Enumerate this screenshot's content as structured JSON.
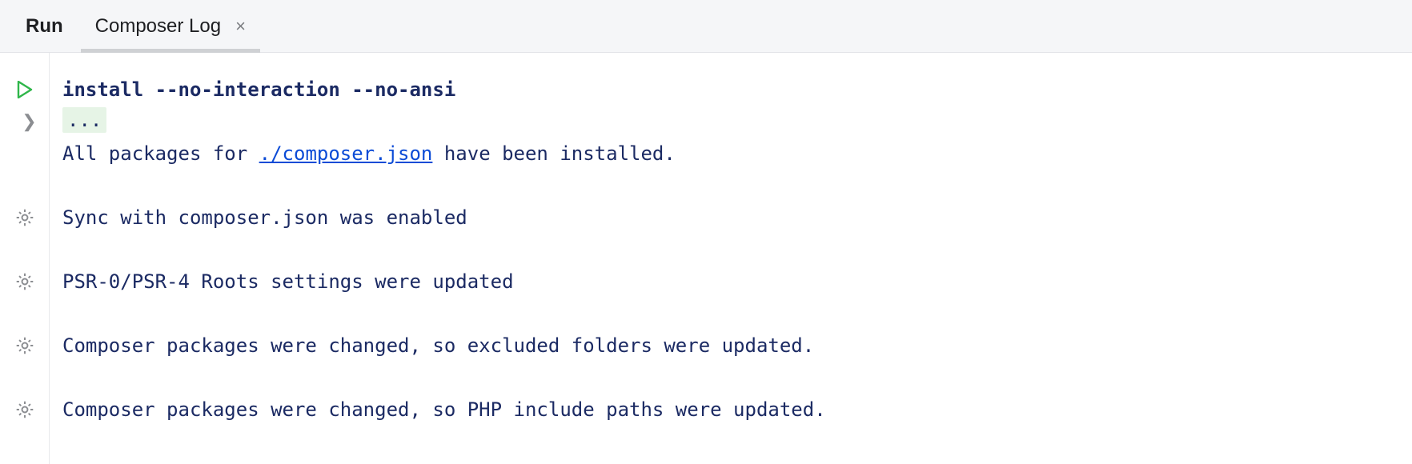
{
  "tabs": {
    "run": "Run",
    "composer": "Composer Log"
  },
  "console": {
    "command": "install --no-interaction --no-ansi",
    "fold": "...",
    "line_packages_pre": "All packages for ",
    "line_packages_link": "./composer.json",
    "line_packages_post": " have been installed.",
    "line_sync": "Sync with composer.json was enabled",
    "line_psr": "PSR-0/PSR-4 Roots settings were updated",
    "line_excluded": "Composer packages were changed, so excluded folders were updated.",
    "line_include": "Composer packages were changed, so PHP include paths were updated."
  }
}
